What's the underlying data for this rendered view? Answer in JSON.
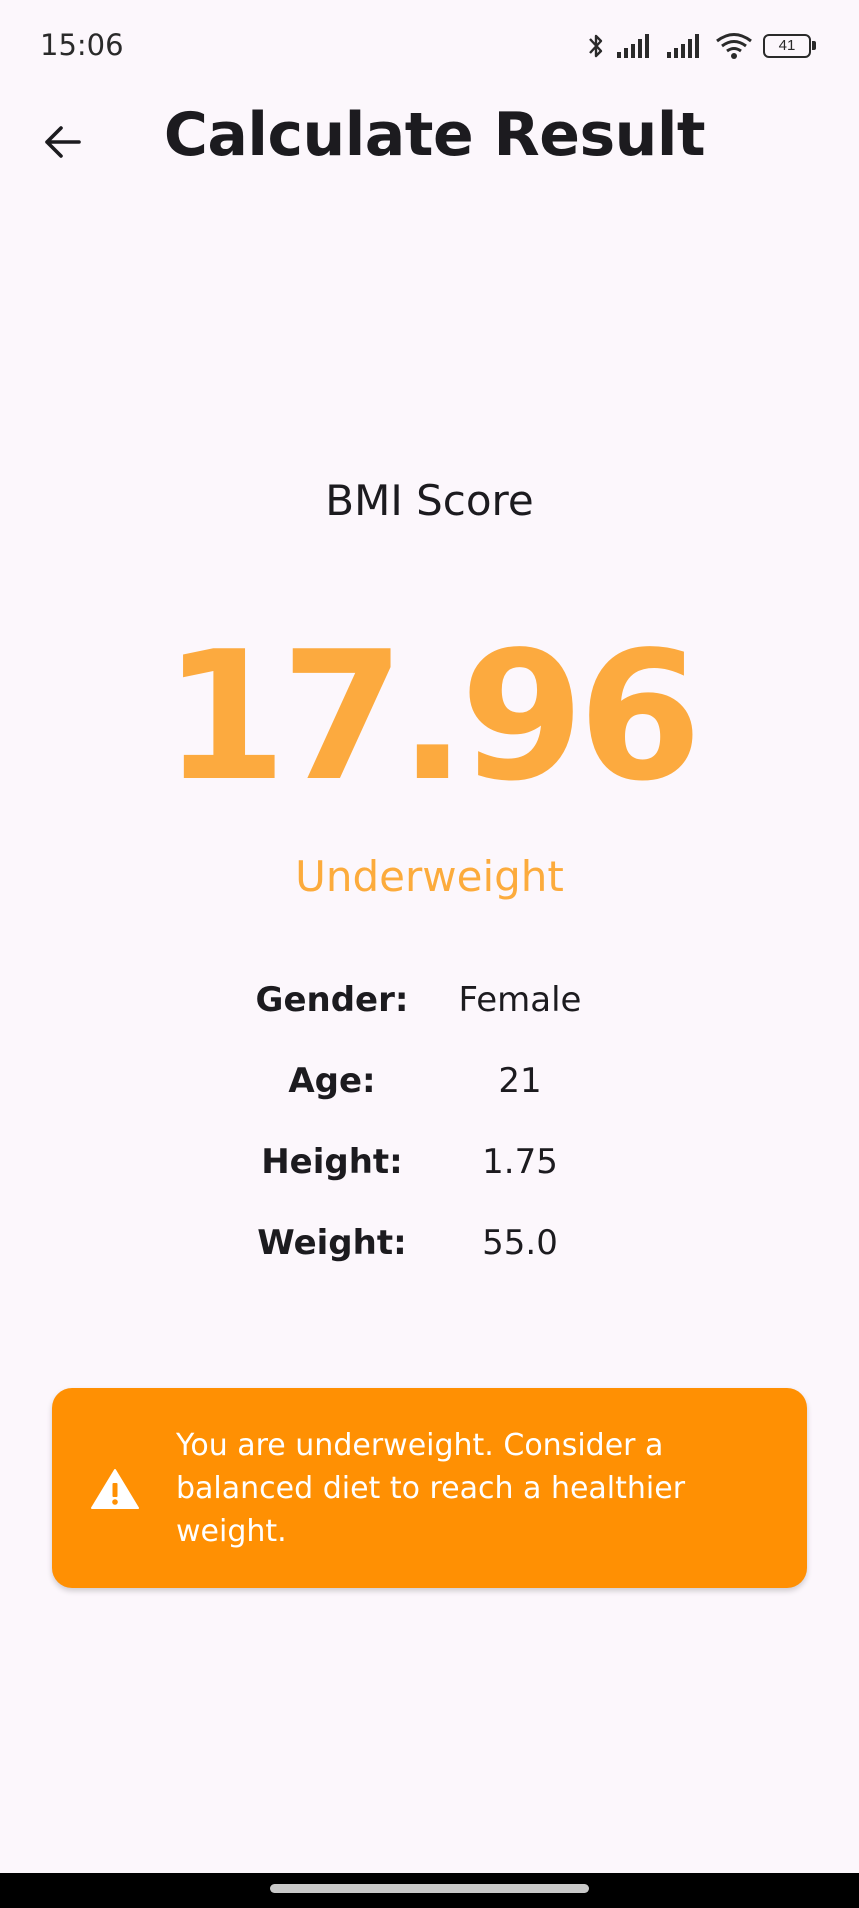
{
  "status_bar": {
    "time": "15:06",
    "battery_level": "41",
    "icons": [
      "bluetooth-icon",
      "signal-icon",
      "signal-icon",
      "wifi-icon",
      "battery-icon"
    ]
  },
  "app_bar": {
    "title": "Calculate Result",
    "back_icon": "arrow-left-icon"
  },
  "result": {
    "score_label": "BMI Score",
    "score": "17.96",
    "category": "Underweight"
  },
  "details": [
    {
      "label": "Gender:",
      "value": "Female"
    },
    {
      "label": "Age:",
      "value": "21"
    },
    {
      "label": "Height:",
      "value": "1.75"
    },
    {
      "label": "Weight:",
      "value": "55.0"
    }
  ],
  "advice": {
    "icon": "warning-icon",
    "text": "You are underweight. Consider a balanced diet to reach a healthier weight."
  },
  "colors": {
    "background": "#fcf7fc",
    "score": "#fcaa3f",
    "card": "#ff9003"
  }
}
